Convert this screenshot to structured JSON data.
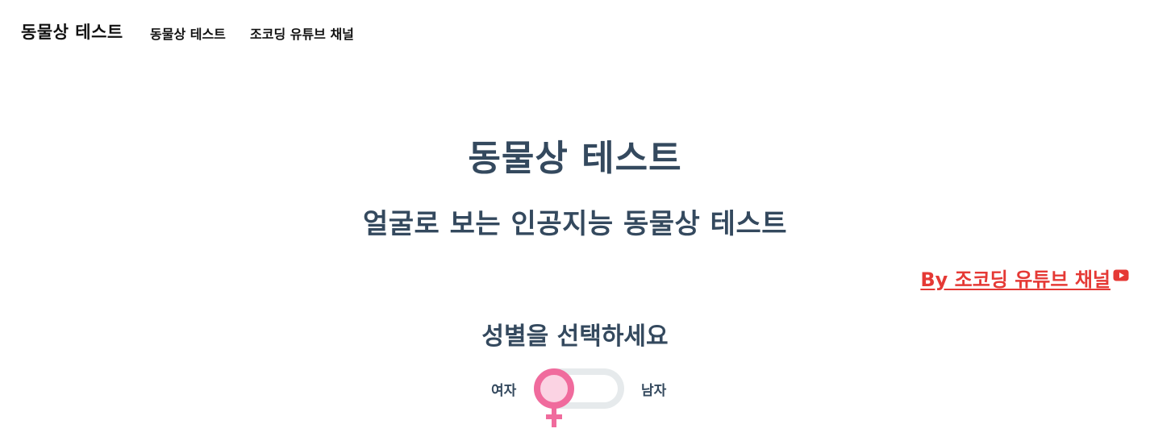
{
  "navbar": {
    "brand": "동물상 테스트",
    "links": [
      {
        "label": "동물상 테스트"
      },
      {
        "label": "조코딩 유튜브 채널"
      }
    ]
  },
  "main": {
    "title": "동물상 테스트",
    "subtitle": "얼굴로 보는 인공지능 동물상 테스트",
    "credit": "By 조코딩 유튜브 채널",
    "credit_icon": "youtube-icon"
  },
  "gender": {
    "prompt": "성별을 선택하세요",
    "female_label": "여자",
    "male_label": "남자",
    "selected": "여자",
    "knob_icon": "female-symbol-icon"
  },
  "colors": {
    "heading": "#34495e",
    "credit": "#e53935",
    "toggle_accent": "#f06b9d",
    "toggle_track": "#e6eaec"
  }
}
